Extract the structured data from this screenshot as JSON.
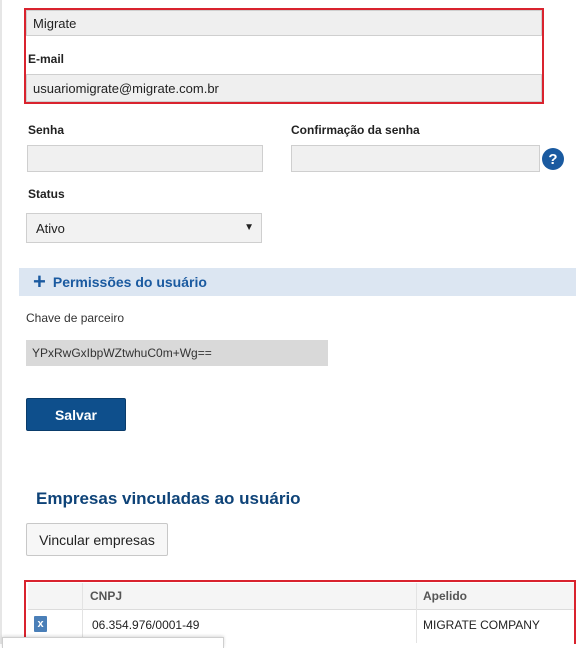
{
  "user": {
    "name_value": "Migrate",
    "email_label": "E-mail",
    "email_value": "usuariomigrate@migrate.com.br"
  },
  "password": {
    "senha_label": "Senha",
    "senha_value": "",
    "confirm_label": "Confirmação da senha",
    "confirm_value": "",
    "help_icon": "question-circle-icon",
    "help_glyph": "?"
  },
  "status": {
    "label": "Status",
    "selected": "Ativo",
    "arrow": "▼"
  },
  "permissions": {
    "plus_glyph": "+",
    "title": "Permissões do usuário"
  },
  "partner_key": {
    "label": "Chave de parceiro",
    "value": "YPxRwGxIbpWZtwhuC0m+Wg=="
  },
  "save_button": "Salvar",
  "companies": {
    "title": "Empresas vinculadas ao usuário",
    "link_button": "Vincular empresas",
    "columns": [
      "CNPJ",
      "Apelido"
    ],
    "rows": [
      {
        "cnpj": "06.354.976/0001-49",
        "apelido": "MIGRATE COMPANY",
        "icon_glyph": "x"
      }
    ]
  },
  "colors": {
    "highlight_border": "#d9232e",
    "accent": "#1a5aa0",
    "primary_button": "#0e4f8c"
  }
}
